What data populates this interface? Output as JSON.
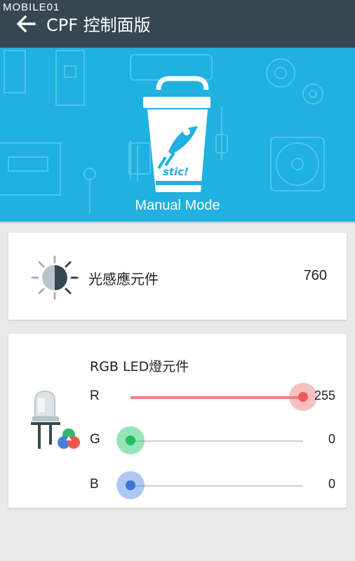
{
  "watermark": "MOBILE01",
  "appbar": {
    "title": "CPF 控制面版"
  },
  "hero": {
    "mode_label": "Manual Mode"
  },
  "light_sensor": {
    "label": "光感應元件",
    "value": "760"
  },
  "rgb_led": {
    "title": "RGB LED燈元件",
    "channels": [
      {
        "label": "R",
        "value": "255",
        "level": 1.0,
        "color": "#f08080",
        "thumb_color": "#ee5a5a"
      },
      {
        "label": "G",
        "value": "0",
        "level": 0.0,
        "color": "#2ecc71",
        "thumb_color": "#1fbf62"
      },
      {
        "label": "B",
        "value": "0",
        "level": 0.0,
        "color": "#5c8fe6",
        "thumb_color": "#3d74d9"
      }
    ]
  },
  "colors": {
    "appbar": "#37474f",
    "hero": "#1fb1e0",
    "background": "#e9e9e9"
  },
  "icons": [
    "back-arrow-icon",
    "cup-logo-icon",
    "light-sensor-icon",
    "led-bulb-icon"
  ]
}
